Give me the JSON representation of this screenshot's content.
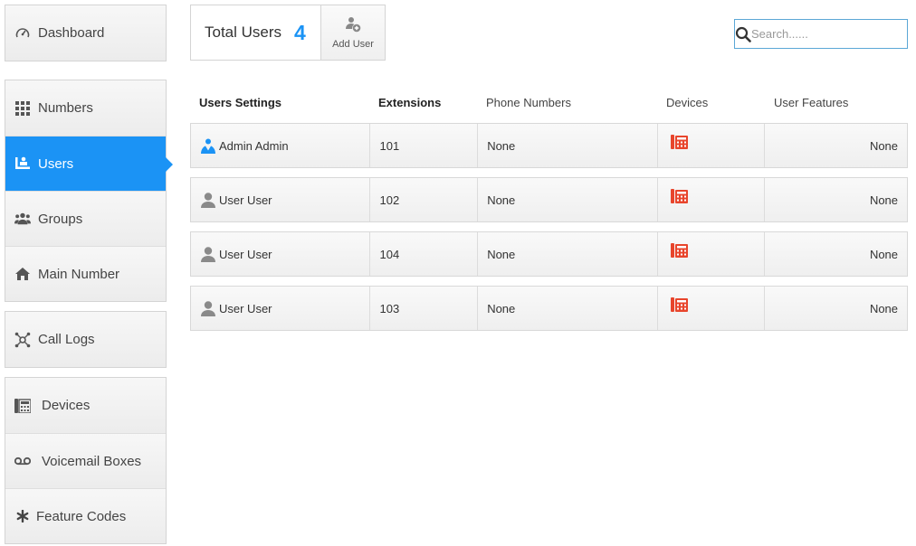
{
  "sidebar": {
    "groups": [
      [
        {
          "label": "Dashboard",
          "icon": "dashboard-gauge-icon"
        }
      ],
      [
        {
          "label": "Numbers",
          "icon": "grid-icon"
        },
        {
          "label": "Users",
          "icon": "users-icon",
          "active": true
        },
        {
          "label": "Groups",
          "icon": "groups-icon"
        },
        {
          "label": "Main Number",
          "icon": "home-icon"
        }
      ],
      [
        {
          "label": "Call Logs",
          "icon": "call-logs-icon"
        }
      ],
      [
        {
          "label": "Devices",
          "icon": "device-phone-icon"
        },
        {
          "label": "Voicemail Boxes",
          "icon": "voicemail-icon"
        },
        {
          "label": "Feature Codes",
          "icon": "asterisk-icon"
        }
      ]
    ]
  },
  "stats": {
    "total_label": "Total Users",
    "total_count": "4",
    "add_label": "Add User"
  },
  "search": {
    "placeholder": "Search......",
    "value": ""
  },
  "table": {
    "headers": [
      "Users Settings",
      "Extensions",
      "Phone Numbers",
      "Devices",
      "User Features"
    ],
    "rows": [
      {
        "name": "Admin Admin",
        "role": "admin",
        "extension": "101",
        "phone": "None",
        "features": "None"
      },
      {
        "name": "User User",
        "role": "user",
        "extension": "102",
        "phone": "None",
        "features": "None"
      },
      {
        "name": "User User",
        "role": "user",
        "extension": "104",
        "phone": "None",
        "features": "None"
      },
      {
        "name": "User User",
        "role": "user",
        "extension": "103",
        "phone": "None",
        "features": "None"
      }
    ]
  },
  "colors": {
    "accent": "#1b93f5",
    "device_icon": "#e8452c",
    "user_icon": "#8a8a8a"
  }
}
